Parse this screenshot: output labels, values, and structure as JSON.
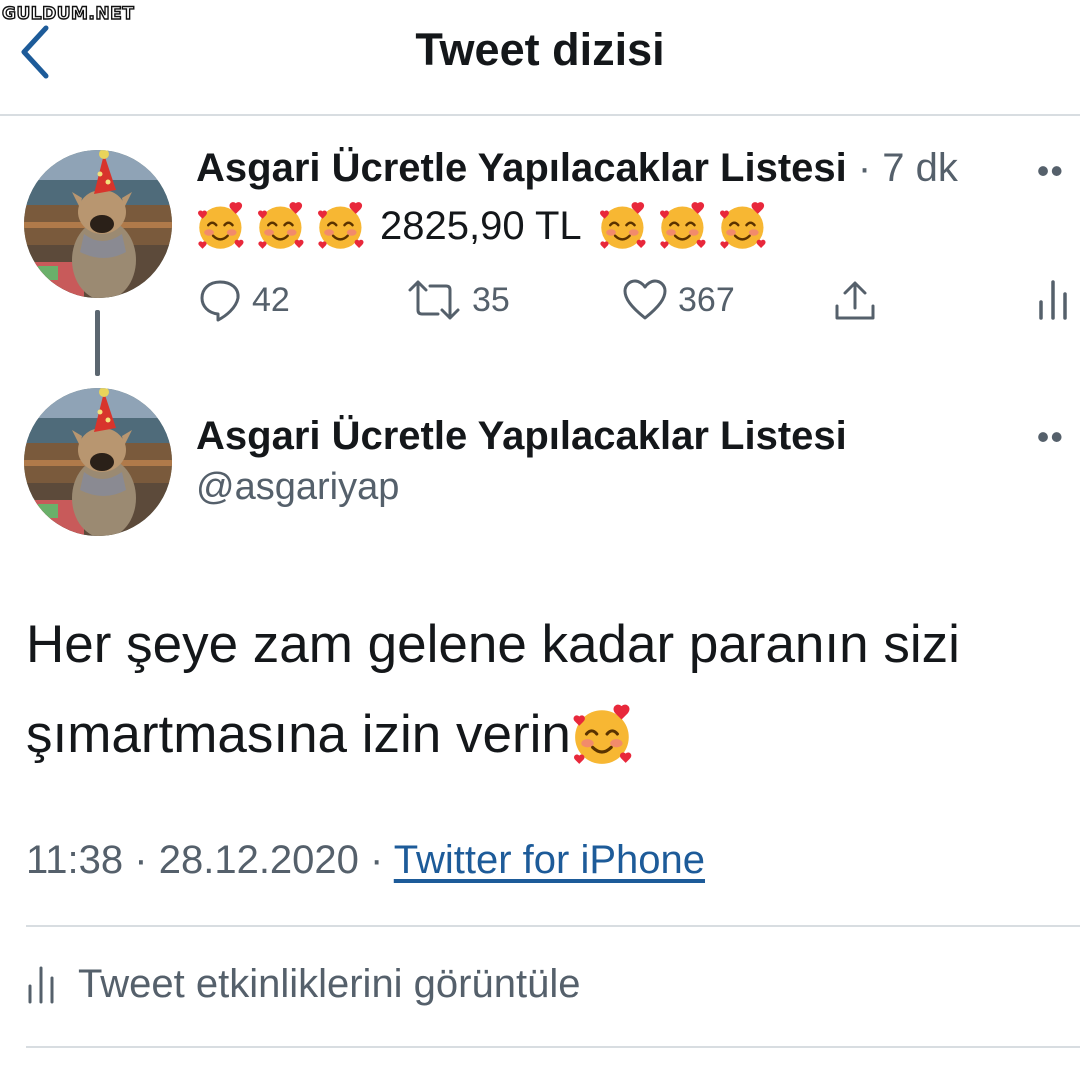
{
  "watermark": "GULDUM.NET",
  "header": {
    "title": "Tweet dizisi",
    "back_icon": "chevron-left-icon"
  },
  "colors": {
    "link": "#1d5b99",
    "secondary": "#55606b",
    "text": "#14171a",
    "divider": "#d8dde1"
  },
  "tweet1": {
    "name": "Asgari Ücretle Yapılacaklar Listesi",
    "time": "· 7 dk",
    "more": "••",
    "text_amount": "2825,90 TL",
    "emoji_icon": "smiling-face-with-hearts-icon",
    "emoji_before_count": 3,
    "emoji_after_count": 3,
    "replies": "42",
    "retweets": "35",
    "likes": "367"
  },
  "tweet2": {
    "name": "Asgari Ücretle Yapılacaklar Listesi",
    "handle": "@asgariyap",
    "more": "••",
    "text_line1": "Her şeye zam gelene kadar paranın sizi",
    "text_line2": "şımartmasına izin verin",
    "time": "11:38",
    "sep1": "·",
    "date": "28.12.2020",
    "sep2": "·",
    "source": "Twitter for iPhone",
    "activity_label": "Tweet etkinliklerini görüntüle"
  }
}
